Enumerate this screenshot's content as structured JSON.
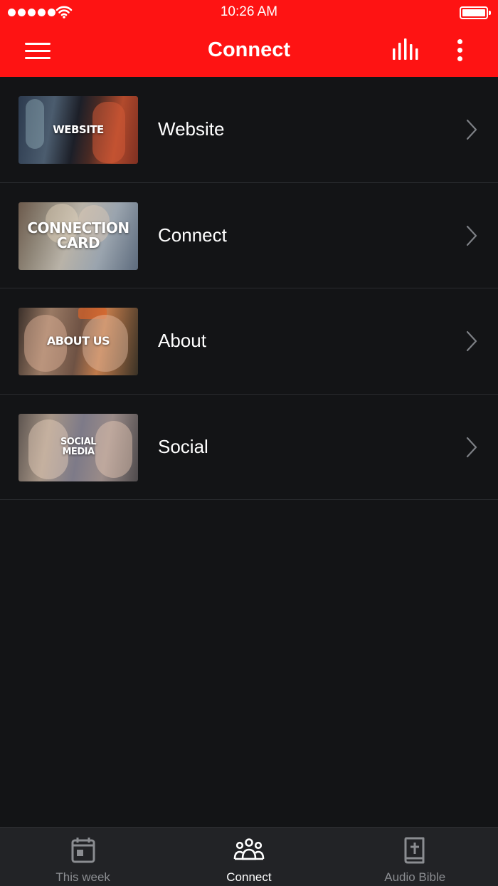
{
  "status_bar": {
    "time": "10:26 AM",
    "signal_icon": "signal-dots-icon",
    "wifi_icon": "wifi-icon",
    "battery_icon": "battery-icon",
    "battery_level": 1.0
  },
  "header": {
    "title": "Connect",
    "menu_icon": "hamburger-menu-icon",
    "audio_icon": "audio-bars-icon",
    "more_icon": "more-vertical-icon",
    "background_color": "#fe1313"
  },
  "items": [
    {
      "label": "Website",
      "thumb_text": "WEBSITE",
      "thumb_icon": "website-thumbnail"
    },
    {
      "label": "Connect",
      "thumb_text": "CONNECTION CARD",
      "thumb_icon": "connection-card-thumbnail"
    },
    {
      "label": "About",
      "thumb_text": "ABOUT US",
      "thumb_icon": "about-us-thumbnail"
    },
    {
      "label": "Social",
      "thumb_text": "SOCIAL MEDIA",
      "thumb_icon": "social-media-thumbnail"
    }
  ],
  "tabs": [
    {
      "label": "This week",
      "icon": "calendar-icon",
      "active": false
    },
    {
      "label": "Connect",
      "icon": "people-group-icon",
      "active": true
    },
    {
      "label": "Audio Bible",
      "icon": "bible-icon",
      "active": false
    }
  ],
  "colors": {
    "accent": "#fe1313",
    "background": "#131416",
    "tab_bar": "#222326",
    "tab_inactive": "#8b8d91"
  }
}
